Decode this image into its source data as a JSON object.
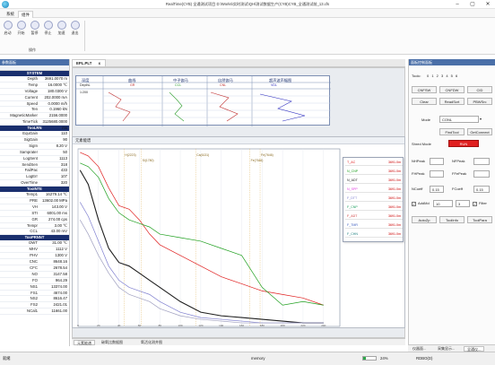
{
  "window": {
    "title": "RealTime(CYB) 全通测试项目 D:\\Works\\实时测试\\QH\\测试数据生产(CYB)CYB_全通测试前_13.cfs",
    "min": "–",
    "max": "▢",
    "close": "✕"
  },
  "menu": {
    "tabs": [
      "系统",
      "组件"
    ],
    "active": 1
  },
  "ribbon": {
    "buttons": [
      {
        "label": "启动",
        "icon": "play-icon"
      },
      {
        "label": "开始",
        "icon": "start-icon"
      },
      {
        "label": "暂停",
        "icon": "pause-icon"
      },
      {
        "label": "停止",
        "icon": "stop-icon"
      },
      {
        "label": "加速",
        "icon": "speed-icon"
      },
      {
        "label": "退出",
        "icon": "exit-icon"
      }
    ],
    "group_label": "操作"
  },
  "left_panel": {
    "title": "参数面板",
    "sections": [
      {
        "name": "SYSTEM",
        "rows": [
          [
            "Depth",
            "3691.0070 m"
          ],
          [
            "Temp",
            "16.0000 ℃"
          ],
          [
            "Voltage",
            "180.0300 V"
          ],
          [
            "Current",
            "202.0000 mA"
          ],
          [
            "Speed",
            "0.0000 m/h"
          ],
          [
            "Ten",
            "0.1960 kN"
          ],
          [
            "MagneticMarker",
            "2156.0000"
          ],
          [
            "TimeTick",
            "3125680.0000 ms"
          ]
        ]
      },
      {
        "name": "TooLRN",
        "rows": [
          [
            "EquGain",
            "110"
          ],
          [
            "SigGain",
            "90"
          ],
          [
            "SigIn",
            "8.20 V"
          ],
          [
            "Samprater",
            "50"
          ],
          [
            "LogSent",
            "1113"
          ],
          [
            "SendSen",
            "318"
          ],
          [
            "FailPac",
            "433"
          ],
          [
            "LogErr",
            "107"
          ],
          [
            "OverTime",
            "320"
          ]
        ]
      },
      {
        "name": "TooINTE",
        "rows": [
          [
            "Temp1",
            "16279.14 ℃"
          ],
          [
            "PRE",
            "13602.00 MPa"
          ],
          [
            "VH",
            "143.00 V"
          ],
          [
            "STI",
            "6001.00 ms"
          ],
          [
            "GR",
            "274.00 cps"
          ],
          [
            "Tempr",
            "3.00 ℃"
          ],
          [
            "CCL",
            "43.00 mV"
          ]
        ]
      },
      {
        "name": "TooPRNNT",
        "rows": [
          [
            "DWT",
            "31.00 ℃"
          ],
          [
            "MHV",
            "1112 V"
          ],
          [
            "PHV",
            "1300 V"
          ],
          [
            "CNC",
            "8648.16"
          ],
          [
            "CFC",
            "2678.54"
          ],
          [
            "NO",
            "3147.58"
          ],
          [
            "FO",
            "964.29"
          ],
          [
            "NS1",
            "13374.00"
          ],
          [
            "FS1",
            "4674.00"
          ],
          [
            "NS2",
            "8616.47"
          ],
          [
            "FS2",
            "2421.01"
          ],
          [
            "NCal1",
            "11661.00"
          ]
        ]
      }
    ]
  },
  "document": {
    "tab": "EPL.PLT",
    "tab_close": "x",
    "table_headers": [
      "深度",
      "曲线",
      "中子伽马",
      "自然伽马",
      "超声波声幅图"
    ],
    "table_subheaders": [
      "DepthL",
      "GR",
      "CCL",
      "CNL",
      "VDL"
    ],
    "table_depth_value": "1:200"
  },
  "chart_window": {
    "title": "元素能谱",
    "markers": [
      "H(2223)",
      "Si(1780)",
      "Ca(6131)",
      "Fe(7646)",
      "Fe(7646)"
    ]
  },
  "legend": {
    "rows": [
      {
        "name": "T_AC",
        "value": "3691.0m",
        "color": "#e02020"
      },
      {
        "name": "N_CNP",
        "value": "3691.0m",
        "color": "#20a020"
      },
      {
        "name": "N_ADT",
        "value": "3691.0m",
        "color": "#202020"
      },
      {
        "name": "N_SPP",
        "value": "3691.0m",
        "color": "#e040e0"
      },
      {
        "name": "F_DTT",
        "value": "3691.0m",
        "color": "#8080d0"
      },
      {
        "name": "F_CNP",
        "value": "3691.0m",
        "color": "#20a060"
      },
      {
        "name": "F_ADT",
        "value": "3691.0m",
        "color": "#d04040"
      },
      {
        "name": "F_TMR",
        "value": "3691.0m",
        "color": "#4060c0"
      },
      {
        "name": "F_CHN",
        "value": "3691.0m",
        "color": "#208080"
      }
    ]
  },
  "chart_data": {
    "type": "line",
    "title": "元素能谱",
    "xlabel": "",
    "ylabel": "",
    "xlim": [
      0,
      256
    ],
    "ylim": [
      0,
      100
    ],
    "x_ticks": [
      0,
      20,
      40,
      60,
      80,
      100,
      120,
      140,
      160,
      180,
      200,
      220,
      240
    ],
    "series": [
      {
        "color": "#e02020",
        "x": [
          2,
          10,
          20,
          30,
          40,
          50,
          60,
          70,
          80,
          100,
          120,
          140,
          160,
          180,
          200,
          220,
          240
        ],
        "values": [
          98,
          96,
          90,
          78,
          68,
          66,
          60,
          52,
          46,
          40,
          34,
          28,
          24,
          20,
          18,
          16,
          12
        ]
      },
      {
        "color": "#20a020",
        "x": [
          2,
          10,
          20,
          30,
          40,
          50,
          60,
          70,
          80,
          100,
          120,
          140,
          160,
          180,
          200,
          220,
          240
        ],
        "values": [
          92,
          90,
          84,
          72,
          64,
          60,
          58,
          56,
          52,
          50,
          48,
          44,
          40,
          22,
          12,
          14,
          12
        ]
      },
      {
        "color": "#202020",
        "x": [
          2,
          10,
          20,
          30,
          40,
          50,
          60,
          70,
          80,
          100,
          120,
          140,
          160,
          180,
          200,
          220,
          240
        ],
        "values": [
          88,
          80,
          60,
          44,
          36,
          34,
          30,
          26,
          22,
          14,
          8,
          6,
          5,
          4,
          3,
          2,
          2
        ]
      },
      {
        "color": "#8080d0",
        "x": [
          2,
          10,
          20,
          30,
          40,
          50,
          60,
          70,
          80,
          100,
          120,
          140,
          160,
          180,
          200,
          220,
          240
        ],
        "values": [
          70,
          62,
          48,
          34,
          26,
          22,
          20,
          18,
          14,
          8,
          5,
          4,
          3,
          2,
          2,
          2,
          2
        ]
      },
      {
        "color": "#a0a0c0",
        "x": [
          2,
          10,
          20,
          30,
          40,
          50,
          60,
          70,
          80,
          100,
          120,
          140,
          160,
          180,
          200,
          220,
          240
        ],
        "values": [
          60,
          52,
          40,
          30,
          22,
          18,
          16,
          14,
          10,
          6,
          4,
          3,
          2,
          2,
          2,
          2,
          2
        ]
      }
    ]
  },
  "doc_bottom_tabs": [
    "元素能谱",
    "碳氧比数据图",
    "氧活化测井图"
  ],
  "right_panel": {
    "title": "面板控制面板",
    "toolc_label": "Toolc:",
    "toolc_values": "0 1 2 3 4 5 6",
    "buttons_row1": [
      "CNFSW",
      "CNFDW",
      "CID"
    ],
    "buttons_row2": [
      "Clear",
      "ReadScrt",
      "PBWSrc"
    ],
    "mode_label": "Mode",
    "mode_value": "CONL",
    "buttons_row3": [
      "FindTool",
      "GetConnect"
    ],
    "shred_mode_label": "Shred Mode",
    "shred_mode_value": "RUN",
    "peak_fields": [
      {
        "label": "NHPeak",
        "value": ""
      },
      {
        "label": "NFPeak",
        "value": ""
      },
      {
        "label": "FHPeak",
        "value": ""
      },
      {
        "label": "FFePeak",
        "value": ""
      }
    ],
    "coeff_fields": [
      {
        "label": "NCoeff",
        "value": "0.15"
      },
      {
        "label": "FCoeff",
        "value": "0.15"
      }
    ],
    "addmode_label": "AddMd",
    "addmode_value": "10",
    "addmode_spin": "3",
    "filter_label": "Filter",
    "buttons_row4": [
      "AutoZp",
      "ToolInfo",
      "ToolPara"
    ]
  },
  "right_bottom_tabs": [
    "仪器面...",
    "采集显示...",
    "全通仪..."
  ],
  "statusbar": {
    "left": "就绪",
    "memory": "memory",
    "percent": "24%",
    "progress": 0.24,
    "right": "RDBO(D)"
  }
}
